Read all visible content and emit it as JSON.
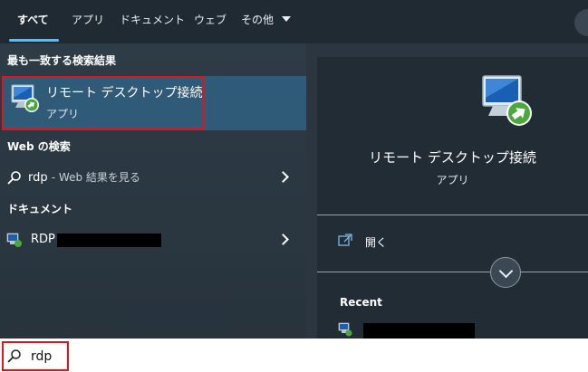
{
  "tabs": [
    {
      "label": "すべて"
    },
    {
      "label": "アプリ"
    },
    {
      "label": "ドキュメント"
    },
    {
      "label": "ウェブ"
    },
    {
      "label": "その他"
    }
  ],
  "best_match": {
    "heading": "最も一致する検索結果",
    "title": "リモート デスクトップ接続",
    "subtitle": "アプリ"
  },
  "web": {
    "heading": "Web の検索",
    "query": "rdp",
    "suffix": "- Web 結果を見る"
  },
  "documents": {
    "heading": "ドキュメント",
    "item": "RDP"
  },
  "details": {
    "app_name": "リモート デスクトップ接続",
    "app_type": "アプリ",
    "open_label": "開く",
    "recent_heading": "Recent"
  },
  "search": {
    "value": "rdp"
  },
  "colors": {
    "accent": "#4cc2ff",
    "highlight": "#e0151b",
    "selected_row": "#2f5a78"
  }
}
